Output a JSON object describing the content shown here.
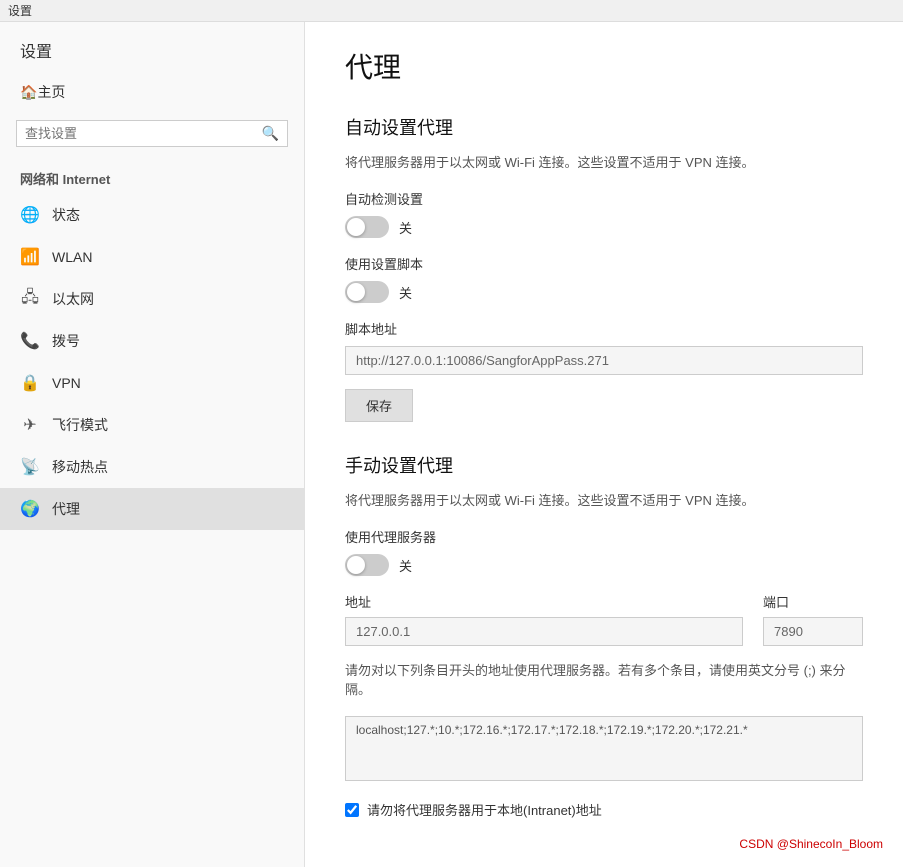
{
  "topbar": {
    "title": "设置"
  },
  "sidebar": {
    "title": "设置",
    "home_label": "主页",
    "search_placeholder": "查找设置",
    "section_label": "网络和 Internet",
    "items": [
      {
        "id": "status",
        "label": "状态",
        "icon": "🌐"
      },
      {
        "id": "wlan",
        "label": "WLAN",
        "icon": "📶"
      },
      {
        "id": "ethernet",
        "label": "以太网",
        "icon": "🔌"
      },
      {
        "id": "dial",
        "label": "拨号",
        "icon": "📞"
      },
      {
        "id": "vpn",
        "label": "VPN",
        "icon": "🔒"
      },
      {
        "id": "airplane",
        "label": "飞行模式",
        "icon": "✈"
      },
      {
        "id": "hotspot",
        "label": "移动热点",
        "icon": "📡"
      },
      {
        "id": "proxy",
        "label": "代理",
        "icon": "🌍"
      }
    ]
  },
  "main": {
    "page_title": "代理",
    "auto_section": {
      "title": "自动设置代理",
      "desc": "将代理服务器用于以太网或 Wi-Fi 连接。这些设置不适用于 VPN 连接。",
      "auto_detect_label": "自动检测设置",
      "auto_detect_state": "关",
      "auto_detect_on": false,
      "use_script_label": "使用设置脚本",
      "use_script_state": "关",
      "use_script_on": false,
      "script_address_label": "脚本地址",
      "script_address_value": "http://127.0.0.1:10086/SangforAppPass.271",
      "save_label": "保存"
    },
    "manual_section": {
      "title": "手动设置代理",
      "desc": "将代理服务器用于以太网或 Wi-Fi 连接。这些设置不适用于 VPN 连接。",
      "use_proxy_label": "使用代理服务器",
      "use_proxy_state": "关",
      "use_proxy_on": false,
      "address_label": "地址",
      "address_value": "127.0.0.1",
      "port_label": "端口",
      "port_value": "7890",
      "exceptions_desc": "请勿对以下列条目开头的地址使用代理服务器。若有多个条目，请使用英文分号 (;) 来分隔。",
      "exceptions_value": "localhost;127.*;10.*;172.16.*;172.17.*;172.18.*;172.19.*;172.20.*;172.21.*",
      "local_checkbox_label": "请勿将代理服务器用于本地(Intranet)地址",
      "local_checked": true
    }
  },
  "watermark": "CSDN @ShinecoIn_Bloom"
}
